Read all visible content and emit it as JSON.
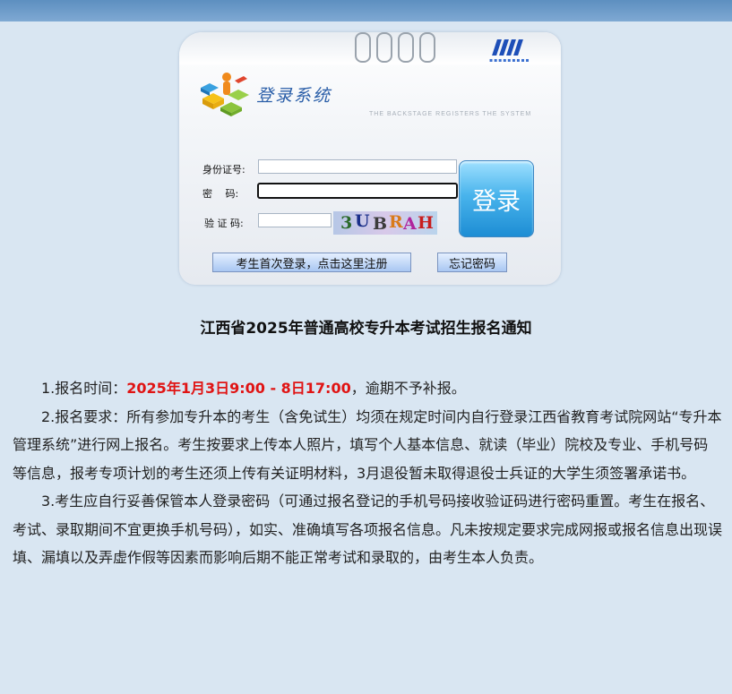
{
  "login": {
    "title": "登录系统",
    "subtitle": "THE BACKSTAGE REGISTERS THE SYSTEM",
    "id_label": "身份证号:",
    "id_value": "",
    "password_label": "密　 码:",
    "password_value": "",
    "captcha_label": "验 证 码:",
    "captcha_value": "",
    "captcha_text": "3UBRAH",
    "login_button": "登录",
    "register_link": "考生首次登录，点击这里注册",
    "forgot_link": "忘记密码",
    "accent_color": "#2a8fd6"
  },
  "notice": {
    "title": "江西省2025年普通高校专升本考试招生报名通知",
    "item1_prefix": "1.报名时间：",
    "item1_time": "2025年1月3日9:00 - 8日17:00",
    "item1_suffix": "，逾期不予补报。",
    "item2": "2.报名要求：所有参加专升本的考生（含免试生）均须在规定时间内自行登录江西省教育考试院网站“专升本管理系统”进行网上报名。考生按要求上传本人照片，填写个人基本信息、就读（毕业）院校及专业、手机号码等信息，报考专项计划的考生还须上传有关证明材料，3月退役暂未取得退役士兵证的大学生须签署承诺书。",
    "item3": "3.考生应自行妥善保管本人登录密码（可通过报名登记的手机号码接收验证码进行密码重置。考生在报名、考试、录取期间不宜更换手机号码），如实、准确填写各项报名信息。凡未按规定要求完成网报或报名信息出现误填、漏填以及弄虚作假等因素而影响后期不能正常考试和录取的，由考生本人负责。",
    "highlight_color": "#e01414"
  }
}
